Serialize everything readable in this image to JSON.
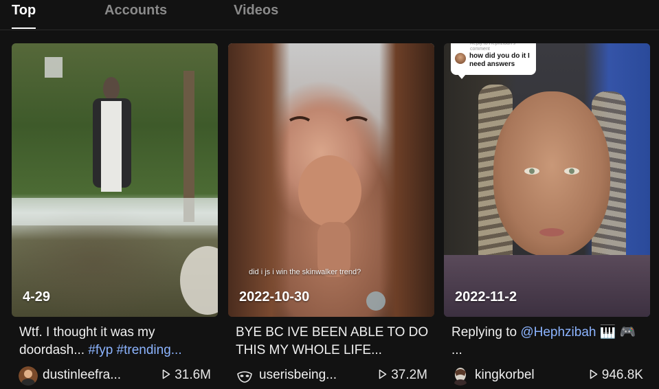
{
  "tabs": [
    {
      "label": "Top",
      "active": true
    },
    {
      "label": "Accounts",
      "active": false
    },
    {
      "label": "Videos",
      "active": false
    }
  ],
  "videos": [
    {
      "date": "4-29",
      "caption_text": "Wtf. I thought it was my doordash... ",
      "caption_tags": "#fyp #trending...",
      "username": "dustinleefra...",
      "views": "31.6M",
      "avatar_icon": "user-avatar-icon"
    },
    {
      "date": "2022-10-30",
      "overlay_text": "did i js i win the skinwalker trend?",
      "caption_text": "BYE BC IVE BEEN ABLE TO DO THIS MY WHOLE LIFE...",
      "username": "userisbeing...",
      "views": "37.2M",
      "avatar_icon": "mask-avatar-icon"
    },
    {
      "date": "2022-11-2",
      "reply_header": "Reply to Hephzibah's comment",
      "reply_text": "how did you do it I need answers",
      "caption_text": "Replying to ",
      "caption_mention": "@Hephzibah",
      "caption_emoji": " 🎹 🎮 ...",
      "username": "kingkorbel",
      "views": "946.8K",
      "avatar_icon": "user-avatar-icon"
    }
  ],
  "colors": {
    "background": "#121212",
    "hashtag": "#8cb4ff",
    "tab_inactive": "#8a8a8a"
  }
}
